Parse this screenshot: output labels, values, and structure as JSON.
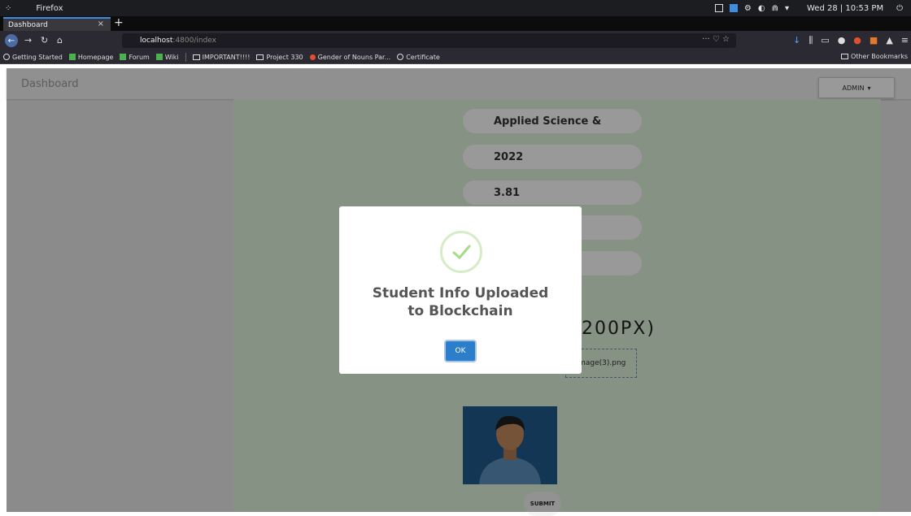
{
  "os": {
    "app_name": "Firefox",
    "clock": "Wed 28 | 10:53 PM"
  },
  "browser": {
    "tab_title": "Dashboard",
    "tab_close": "×",
    "new_tab": "+",
    "url_host": "localhost",
    "url_path": ":4800/index",
    "url_actions": "··· ♡ ☆",
    "bookmarks": [
      {
        "label": "Getting Started",
        "icon": "globe-icon"
      },
      {
        "label": "Homepage",
        "icon": "green-square-icon"
      },
      {
        "label": "Forum",
        "icon": "green-square-icon"
      },
      {
        "label": "Wiki",
        "icon": "green-square-icon"
      },
      {
        "label": "IMPORTANT!!!!",
        "icon": "folder-icon"
      },
      {
        "label": "Project 330",
        "icon": "folder-icon"
      },
      {
        "label": "Gender of Nouns Par...",
        "icon": "red-dot-icon"
      },
      {
        "label": "Certificate",
        "icon": "globe-icon"
      }
    ],
    "other_bookmarks": "Other Bookmarks"
  },
  "header": {
    "title": "Dashboard",
    "admin_label": "ADMIN",
    "admin_caret": "▾"
  },
  "form": {
    "department": "Applied Science &",
    "year": "2022",
    "gpa": "3.81",
    "upload_label": "200PX)",
    "file_name": "image(3).png",
    "submit_label": "SUBMIT"
  },
  "modal": {
    "title": "Student Info Uploaded to Blockchain",
    "ok_label": "OK",
    "success_color": "#a5dc86"
  }
}
